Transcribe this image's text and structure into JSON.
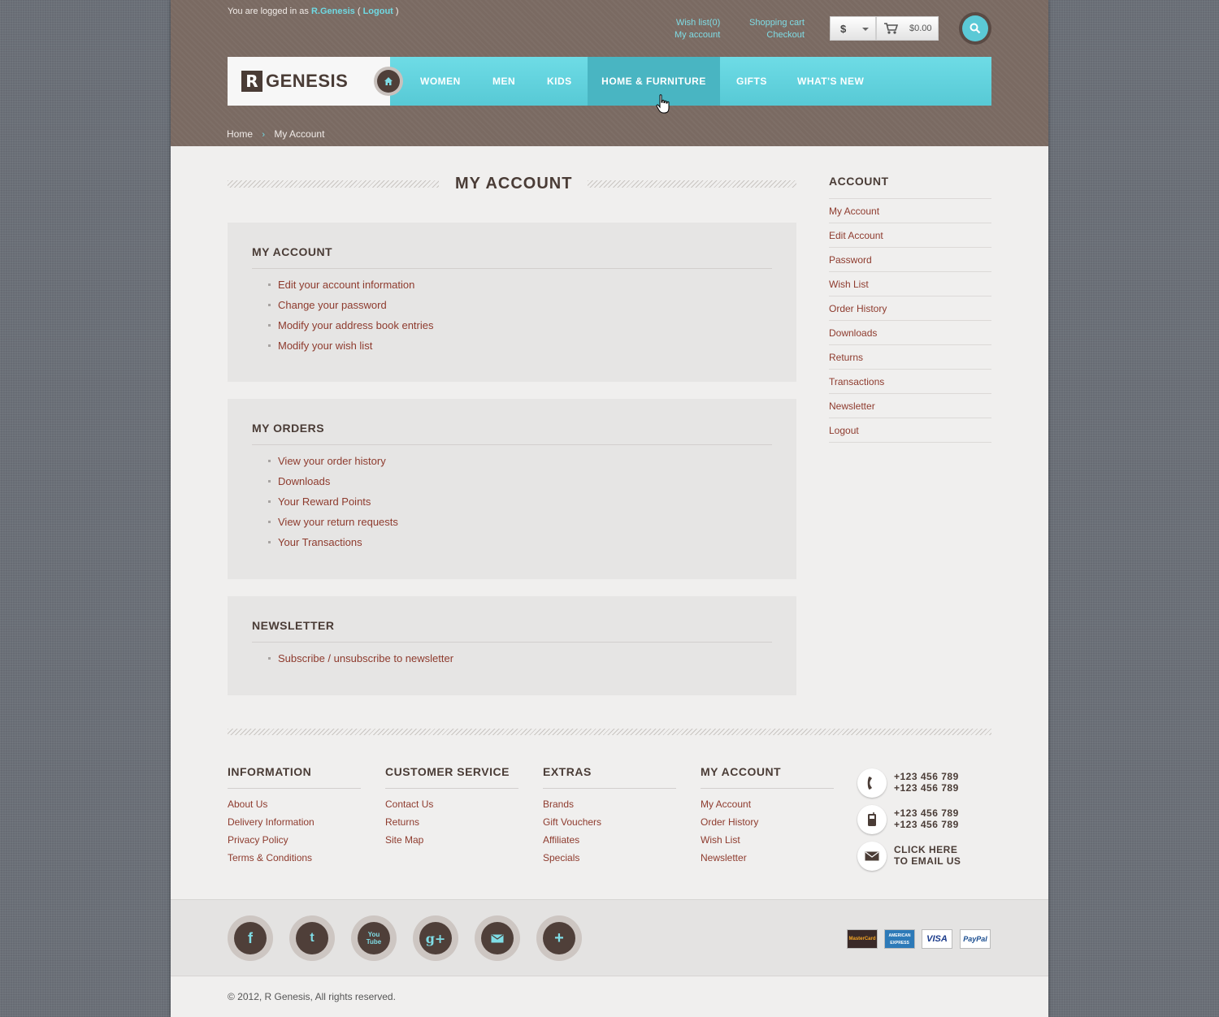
{
  "header": {
    "login_prefix": "You are logged in as",
    "username": "R.Genesis",
    "logout_open": "(",
    "logout_label": "Logout",
    "logout_close": ")",
    "wishlist": "Wish list(0)",
    "my_account": "My account",
    "shopping_cart": "Shopping cart",
    "checkout": "Checkout",
    "currency": "$",
    "cart_total": "$0.00"
  },
  "logo": {
    "mark": "R",
    "text": "GENESIS"
  },
  "nav": {
    "items": [
      "WOMEN",
      "MEN",
      "KIDS",
      "HOME & FURNITURE",
      "GIFTS",
      "WHAT'S NEW"
    ]
  },
  "breadcrumb": {
    "home": "Home",
    "current": "My Account"
  },
  "page_title": "MY ACCOUNT",
  "sections": {
    "account": {
      "title": "MY ACCOUNT",
      "links": [
        "Edit your account information",
        "Change your password",
        "Modify your address book entries",
        "Modify your wish list"
      ]
    },
    "orders": {
      "title": "MY ORDERS",
      "links": [
        "View your order history",
        "Downloads",
        "Your Reward Points",
        "View your return requests",
        "Your Transactions"
      ]
    },
    "newsletter": {
      "title": "NEWSLETTER",
      "links": [
        "Subscribe / unsubscribe to newsletter"
      ]
    }
  },
  "sidebar": {
    "title": "ACCOUNT",
    "items": [
      "My Account",
      "Edit Account",
      "Password",
      "Wish List",
      "Order History",
      "Downloads",
      "Returns",
      "Transactions",
      "Newsletter",
      "Logout"
    ]
  },
  "footer": {
    "columns": [
      {
        "title": "INFORMATION",
        "links": [
          "About Us",
          "Delivery Information",
          "Privacy Policy",
          "Terms & Conditions"
        ]
      },
      {
        "title": "CUSTOMER SERVICE",
        "links": [
          "Contact Us",
          "Returns",
          "Site Map"
        ]
      },
      {
        "title": "EXTRAS",
        "links": [
          "Brands",
          "Gift Vouchers",
          "Affiliates",
          "Specials"
        ]
      },
      {
        "title": "MY ACCOUNT",
        "links": [
          "My Account",
          "Order History",
          "Wish List",
          "Newsletter"
        ]
      }
    ],
    "contact": {
      "phone1": "+123 456 789",
      "phone2": "+123 456 789",
      "mobile1": "+123 456 789",
      "mobile2": "+123 456 789",
      "email1": "CLICK HERE",
      "email2": "TO EMAIL US"
    },
    "social": [
      "facebook-icon",
      "twitter-icon",
      "youtube-icon",
      "google-plus-icon",
      "email-icon",
      "plus-icon"
    ],
    "youtube_text": "You Tube",
    "payments": [
      "MasterCard",
      "AMERICAN EXPRESS",
      "VISA",
      "PayPal"
    ],
    "copyright": "© 2012, R Genesis, All rights reserved."
  },
  "colors": {
    "accent": "#5bc9d6",
    "brand_dark": "#4a3c36",
    "link": "#8e3b2e",
    "header_bg": "#7a6a62"
  }
}
